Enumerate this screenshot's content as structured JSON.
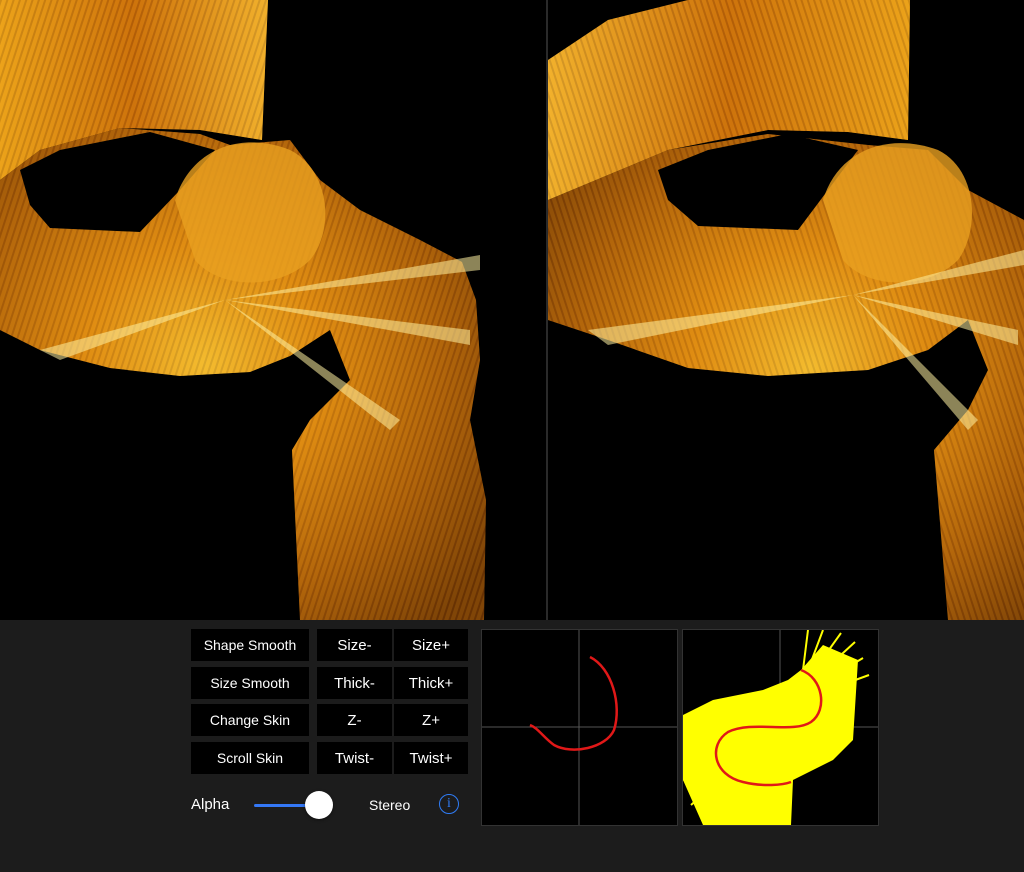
{
  "controls": {
    "shape_smooth": "Shape Smooth",
    "size_minus": "Size-",
    "size_plus": "Size+",
    "size_smooth": "Size Smooth",
    "thick_minus": "Thick-",
    "thick_plus": "Thick+",
    "change_skin": "Change Skin",
    "z_minus": "Z-",
    "z_plus": "Z+",
    "scroll_skin": "Scroll Skin",
    "twist_minus": "Twist-",
    "twist_plus": "Twist+"
  },
  "alpha": {
    "label": "Alpha",
    "value": 0.9
  },
  "stereo": {
    "label": "Stereo"
  },
  "info": {
    "glyph": "i"
  },
  "colors": {
    "accent": "#3478f6",
    "curve": "#e01818",
    "skin_preview": "#ffff00",
    "gold": "#e09010"
  }
}
